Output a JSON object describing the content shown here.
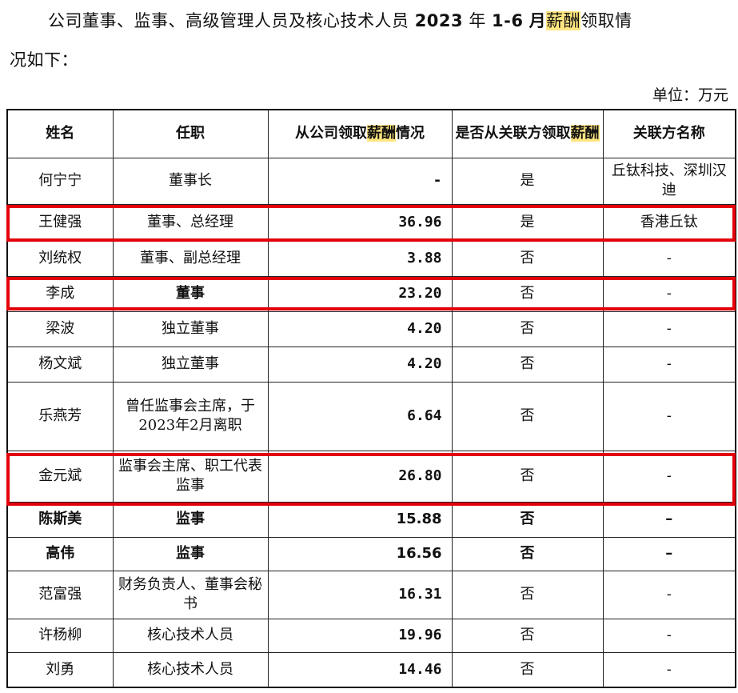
{
  "intro": {
    "prefix": "公司董事、监事、高级管理人员及核心技术人员",
    "year": "2023",
    "year_suffix": "年",
    "months": "1-6",
    "month_suffix": "月",
    "highlight_word": "薪酬",
    "line1_end": "领取情",
    "line2": "况如下："
  },
  "unit_label": "单位：万元",
  "headers": {
    "name": "姓名",
    "position": "任职",
    "salary_prefix": "从公司领取",
    "salary_highlight": "薪酬",
    "salary_suffix": "情况",
    "related_prefix": "是否从关联方领取",
    "related_highlight": "薪酬",
    "related_name": "关联方名称"
  },
  "rows": [
    {
      "name": "何宁宁",
      "position": "董事长",
      "salary": "-",
      "related": "是",
      "related_name": "丘钛科技、深圳汉迪"
    },
    {
      "name": "王健强",
      "position": "董事、总经理",
      "salary": "36.96",
      "related": "是",
      "related_name": "香港丘钛"
    },
    {
      "name": "刘统权",
      "position": "董事、副总经理",
      "salary": "3.88",
      "related": "否",
      "related_name": "-"
    },
    {
      "name": "李成",
      "position": "董事",
      "salary": "23.20",
      "related": "否",
      "related_name": "-"
    },
    {
      "name": "梁波",
      "position": "独立董事",
      "salary": "4.20",
      "related": "否",
      "related_name": "-"
    },
    {
      "name": "杨文斌",
      "position": "独立董事",
      "salary": "4.20",
      "related": "否",
      "related_name": "-"
    },
    {
      "name": "乐燕芳",
      "position": "曾任监事会主席，于2023年2月离职",
      "salary": "6.64",
      "related": "否",
      "related_name": "-"
    },
    {
      "name": "金元斌",
      "position": "监事会主席、职工代表监事",
      "salary": "26.80",
      "related": "否",
      "related_name": "-"
    },
    {
      "name": "陈斯美",
      "position": "监事",
      "salary": "15.88",
      "related": "否",
      "related_name": "–"
    },
    {
      "name": "高伟",
      "position": "监事",
      "salary": "16.56",
      "related": "否",
      "related_name": "–"
    },
    {
      "name": "范富强",
      "position": "财务负责人、董事会秘书",
      "salary": "16.31",
      "related": "否",
      "related_name": "-"
    },
    {
      "name": "许杨柳",
      "position": "核心技术人员",
      "salary": "19.96",
      "related": "否",
      "related_name": "-"
    },
    {
      "name": "刘勇",
      "position": "核心技术人员",
      "salary": "14.46",
      "related": "否",
      "related_name": "-"
    }
  ]
}
